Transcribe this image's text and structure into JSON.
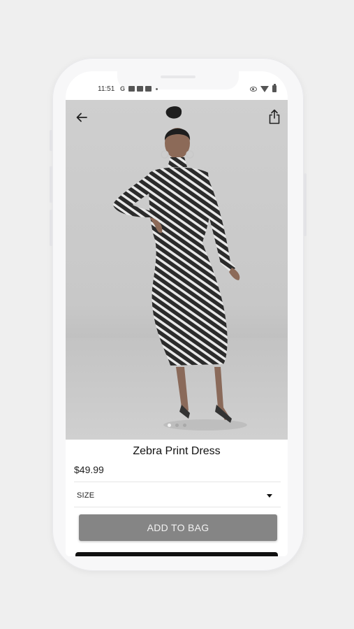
{
  "status_bar": {
    "time": "11:51",
    "left_icons": [
      "google-g-icon",
      "note-icon",
      "square-icon",
      "square-icon",
      "dot-icon"
    ],
    "right_icons": [
      "eye-icon",
      "wifi-icon",
      "battery-icon"
    ]
  },
  "gallery": {
    "back_icon": "arrow-left-icon",
    "share_icon": "share-icon",
    "image_count": 3,
    "active_index": 0
  },
  "product": {
    "title": "Zebra Print Dress",
    "price": "$49.99",
    "size_label": "SIZE",
    "add_to_bag_label": "ADD TO BAG"
  },
  "colors": {
    "button_bg": "#858585",
    "button_text": "#f2f2f2",
    "background": "#efefef",
    "phone_frame": "#f7f7f8"
  }
}
